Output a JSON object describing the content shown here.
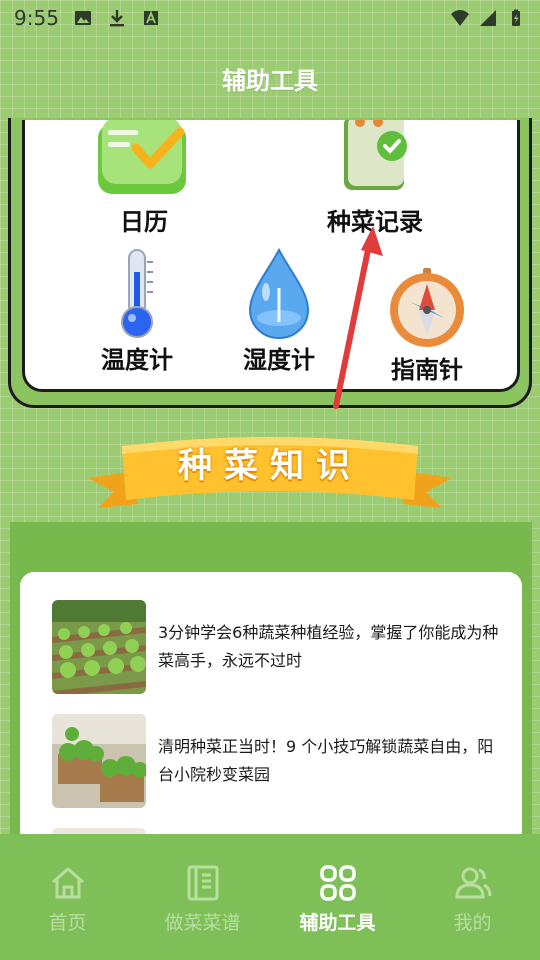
{
  "status_bar": {
    "time": "9:55"
  },
  "header": {
    "title": "辅助工具"
  },
  "tools": [
    {
      "label": "日历",
      "icon": "calendar-icon"
    },
    {
      "label": "种菜记录",
      "icon": "planting-record-icon"
    },
    {
      "label": "温度计",
      "icon": "thermometer-icon"
    },
    {
      "label": "湿度计",
      "icon": "humidity-drop-icon"
    },
    {
      "label": "指南针",
      "icon": "compass-icon"
    }
  ],
  "banner": {
    "text": "种菜知识"
  },
  "articles": [
    {
      "title": "3分钟学会6种蔬菜种植经验，掌握了你能成为种菜高手，永远不过时"
    },
    {
      "title": "清明种菜正当时！9 个小技巧解锁蔬菜自由，阳台小院秒变菜园"
    }
  ],
  "nav": [
    {
      "label": "首页",
      "icon": "home-icon",
      "active": false
    },
    {
      "label": "做菜菜谱",
      "icon": "recipe-book-icon",
      "active": false
    },
    {
      "label": "辅助工具",
      "icon": "grid-tools-icon",
      "active": true
    },
    {
      "label": "我的",
      "icon": "user-icon",
      "active": false
    }
  ],
  "colors": {
    "background": "#9ccc72",
    "nav_bg": "#7fbf57",
    "nav_active": "#ffffff",
    "banner": "#f7b21c",
    "arrow": "#e03c3c"
  }
}
